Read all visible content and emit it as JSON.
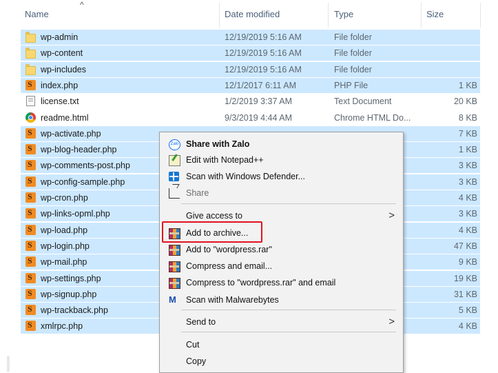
{
  "columns": {
    "name": "Name",
    "date": "Date modified",
    "type": "Type",
    "size": "Size",
    "sort_arrow": "^"
  },
  "files": [
    {
      "name": "wp-admin",
      "date": "12/19/2019 5:16 AM",
      "type": "File folder",
      "size": "",
      "icon": "folder-icon",
      "selected": true
    },
    {
      "name": "wp-content",
      "date": "12/19/2019 5:16 AM",
      "type": "File folder",
      "size": "",
      "icon": "folder-icon",
      "selected": true
    },
    {
      "name": "wp-includes",
      "date": "12/19/2019 5:16 AM",
      "type": "File folder",
      "size": "",
      "icon": "folder-icon",
      "selected": true
    },
    {
      "name": "index.php",
      "date": "12/1/2017 6:11 AM",
      "type": "PHP File",
      "size": "1 KB",
      "icon": "php-file-icon",
      "selected": true
    },
    {
      "name": "license.txt",
      "date": "1/2/2019 3:37 AM",
      "type": "Text Document",
      "size": "20 KB",
      "icon": "text-file-icon",
      "selected": false
    },
    {
      "name": "readme.html",
      "date": "9/3/2019 4:44 AM",
      "type": "Chrome HTML Do...",
      "size": "8 KB",
      "icon": "chrome-icon",
      "selected": false
    },
    {
      "name": "wp-activate.php",
      "date": "",
      "type": "",
      "size": "7 KB",
      "icon": "php-file-icon",
      "selected": true
    },
    {
      "name": "wp-blog-header.php",
      "date": "",
      "type": "",
      "size": "1 KB",
      "icon": "php-file-icon",
      "selected": true
    },
    {
      "name": "wp-comments-post.php",
      "date": "",
      "type": "",
      "size": "3 KB",
      "icon": "php-file-icon",
      "selected": true
    },
    {
      "name": "wp-config-sample.php",
      "date": "",
      "type": "",
      "size": "3 KB",
      "icon": "php-file-icon",
      "selected": true
    },
    {
      "name": "wp-cron.php",
      "date": "",
      "type": "",
      "size": "4 KB",
      "icon": "php-file-icon",
      "selected": true
    },
    {
      "name": "wp-links-opml.php",
      "date": "",
      "type": "",
      "size": "3 KB",
      "icon": "php-file-icon",
      "selected": true
    },
    {
      "name": "wp-load.php",
      "date": "",
      "type": "",
      "size": "4 KB",
      "icon": "php-file-icon",
      "selected": true
    },
    {
      "name": "wp-login.php",
      "date": "",
      "type": "",
      "size": "47 KB",
      "icon": "php-file-icon",
      "selected": true
    },
    {
      "name": "wp-mail.php",
      "date": "",
      "type": "",
      "size": "9 KB",
      "icon": "php-file-icon",
      "selected": true
    },
    {
      "name": "wp-settings.php",
      "date": "",
      "type": "",
      "size": "19 KB",
      "icon": "php-file-icon",
      "selected": true
    },
    {
      "name": "wp-signup.php",
      "date": "",
      "type": "",
      "size": "31 KB",
      "icon": "php-file-icon",
      "selected": true
    },
    {
      "name": "wp-trackback.php",
      "date": "",
      "type": "",
      "size": "5 KB",
      "icon": "php-file-icon",
      "selected": true
    },
    {
      "name": "xmlrpc.php",
      "date": "",
      "type": "",
      "size": "4 KB",
      "icon": "php-file-icon",
      "selected": true
    }
  ],
  "context_menu": {
    "items": [
      {
        "label": "Share with Zalo",
        "icon": "zalo-icon",
        "bold": true
      },
      {
        "label": "Edit with Notepad++",
        "icon": "notepad-plus-plus-icon"
      },
      {
        "label": "Scan with Windows Defender...",
        "icon": "windows-defender-icon"
      },
      {
        "label": "Share",
        "icon": "share-icon",
        "dim": true
      },
      {
        "label": "Give access to",
        "submenu": true
      },
      {
        "label": "Add to archive...",
        "icon": "winrar-icon",
        "highlighted": true
      },
      {
        "label": "Add to \"wordpress.rar\"",
        "icon": "winrar-icon"
      },
      {
        "label": "Compress and email...",
        "icon": "winrar-icon"
      },
      {
        "label": "Compress to \"wordpress.rar\" and email",
        "icon": "winrar-icon"
      },
      {
        "label": "Scan with Malwarebytes",
        "icon": "malwarebytes-icon"
      },
      {
        "label": "Send to",
        "submenu": true
      },
      {
        "label": "Cut"
      },
      {
        "label": "Copy"
      }
    ],
    "submenu_glyph": ">",
    "zalo_icon_text": "Zalo",
    "malwarebytes_glyph": "M"
  },
  "colors": {
    "selection": "#cce8ff",
    "highlight_box": "#e0141e"
  }
}
